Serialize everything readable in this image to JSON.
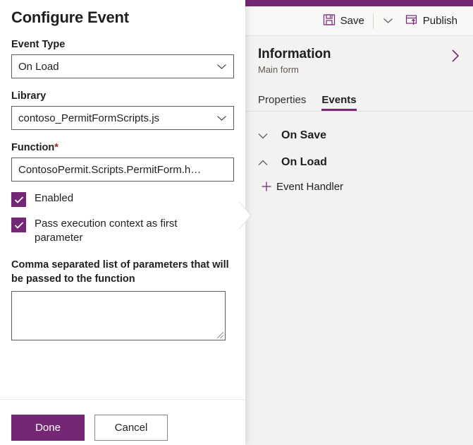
{
  "colors": {
    "accent": "#742774",
    "panel_bg": "#f3f2f1",
    "required_asterisk": "#a4262c"
  },
  "dialog": {
    "title": "Configure Event",
    "fields": {
      "event_type": {
        "label": "Event Type",
        "value": "On Load",
        "chevron": "chevron-down-icon"
      },
      "library": {
        "label": "Library",
        "value": "contoso_PermitFormScripts.js",
        "chevron": "chevron-down-icon"
      },
      "function": {
        "label": "Function",
        "required_mark": "*",
        "value": "ContosoPermit.Scripts.PermitForm.h…",
        "placeholder": ""
      },
      "parameters": {
        "label": "Comma separated list of parameters that will be passed to the function",
        "value": "",
        "placeholder": ""
      }
    },
    "checkboxes": [
      {
        "label": "Enabled",
        "checked": true
      },
      {
        "label": "Pass execution context as first parameter",
        "checked": true
      }
    ],
    "footer": {
      "done_label": "Done",
      "cancel_label": "Cancel"
    }
  },
  "app": {
    "command_bar": {
      "save_label": "Save",
      "save_icon": "save-floppy-icon",
      "save_more_icon": "chevron-down-icon",
      "publish_label": "Publish",
      "publish_icon": "publish-icon"
    },
    "form_header": {
      "title": "Information",
      "subtitle": "Main form",
      "expand_icon": "chevron-right-icon"
    },
    "tabs": [
      {
        "label": "Properties",
        "active": false
      },
      {
        "label": "Events",
        "active": true
      }
    ],
    "events_tree": [
      {
        "label": "On Save",
        "expanded": false,
        "chevron": "chevron-down-icon"
      },
      {
        "label": "On Load",
        "expanded": true,
        "chevron": "chevron-up-icon"
      }
    ],
    "add_handler": {
      "label": "Event Handler",
      "icon": "plus-icon"
    }
  }
}
